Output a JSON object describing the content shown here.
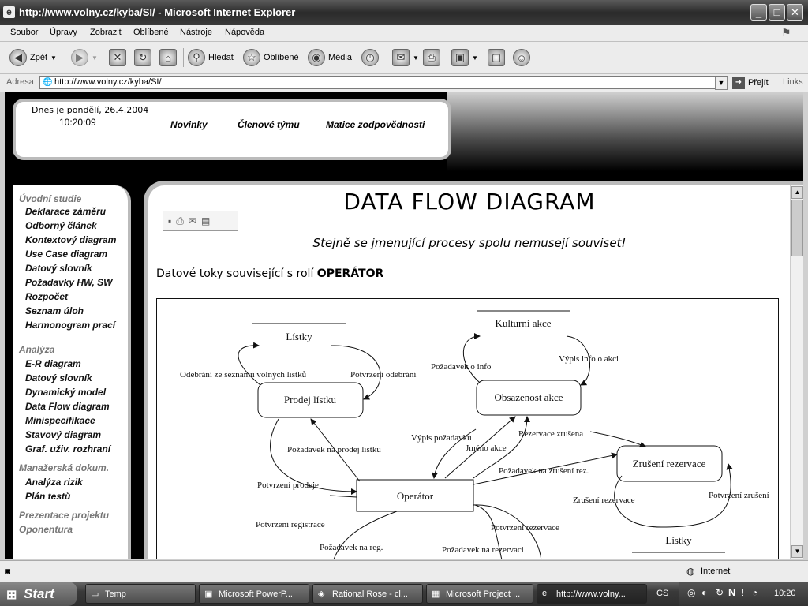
{
  "window": {
    "title": "http://www.volny.cz/kyba/SI/ - Microsoft Internet Explorer"
  },
  "menu": [
    "Soubor",
    "Úpravy",
    "Zobrazit",
    "Oblíbené",
    "Nástroje",
    "Nápověda"
  ],
  "toolbar": {
    "back": "Zpět",
    "search": "Hledat",
    "favorites": "Oblíbené",
    "media": "Média"
  },
  "address": {
    "label": "Adresa",
    "url": "http://www.volny.cz/kyba/SI/",
    "go": "Přejít",
    "links": "Links"
  },
  "header": {
    "date": "Dnes je pondělí, 26.4.2004",
    "time": "10:20:09",
    "nav": [
      "Novinky",
      "Členové týmu",
      "Matice zodpovědnosti"
    ]
  },
  "sidebar": {
    "sections": [
      {
        "title": "Úvodní studie",
        "items": [
          "Deklarace záměru",
          "Odborný článek",
          "Kontextový diagram",
          "Use Case diagram",
          "Datový slovník",
          "Požadavky HW, SW",
          "Rozpočet",
          "Seznam úloh",
          "Harmonogram prací"
        ]
      },
      {
        "title": "Analýza",
        "items": [
          "E-R diagram",
          "Datový slovník",
          "Dynamický model",
          "Data Flow diagram",
          "Minispecifikace",
          "Stavový diagram",
          "Graf. uživ. rozhraní"
        ]
      },
      {
        "title": "Manažerská dokum.",
        "items": [
          "Analýza rizik",
          "Plán testů"
        ]
      },
      {
        "title": "Prezentace projektu",
        "items": []
      },
      {
        "title": "Oponentura",
        "items": []
      }
    ]
  },
  "content": {
    "title": "DATA FLOW DIAGRAM",
    "subtitle": "Stejně se jmenující procesy spolu nemusejí souviset!",
    "intro": "Datové toky související s rolí",
    "role": "OPERÁTOR"
  },
  "diagram": {
    "stores": {
      "listky_top": "Lístky",
      "kulturni_akce": "Kulturní akce",
      "listky_bottom": "Lístky"
    },
    "processes": {
      "prodej": "Prodej lístku",
      "obsazenost": "Obsazenost akce",
      "operator": "Operátor",
      "zruseni": "Zrušení rezervace"
    },
    "flows": {
      "odebrani": "Odebrání ze seznamu volných lístků",
      "potvrzeni_odebrani": "Potvrzení odebrání",
      "pozadavek_o_info": "Požadavek o info",
      "vypis_info": "Výpis info o akci",
      "vypis_pozadavku": "Výpis požadavku",
      "jmeno_akce": "Jméno akce",
      "rezervace_zrusena": "Rezervace zrušena",
      "pozadavek_prodej": "Požadavek na prodej lístku",
      "pozadavek_zruseni": "Požadavek na zrušení rez.",
      "potvrzeni_prodeje": "Potvrzení prodeje",
      "zruseni_rezervace": "Zrušení rezervace",
      "potvrzeni_zruseni": "Potvrzení zrušení",
      "potvrzeni_registrace": "Potvrzení registrace",
      "potvrzeni_rezervace": "Potvrzení rezervace",
      "pozadavek_reg": "Požadavek na reg.",
      "pozadavek_rezervaci": "Požadavek na rezervaci"
    }
  },
  "status": {
    "zone": "Internet"
  },
  "taskbar": {
    "start": "Start",
    "tasks": [
      "Temp",
      "Microsoft PowerP...",
      "Rational Rose - cl...",
      "Microsoft Project ...",
      "http://www.volny..."
    ],
    "lang": "CS",
    "clock": "10:20"
  }
}
